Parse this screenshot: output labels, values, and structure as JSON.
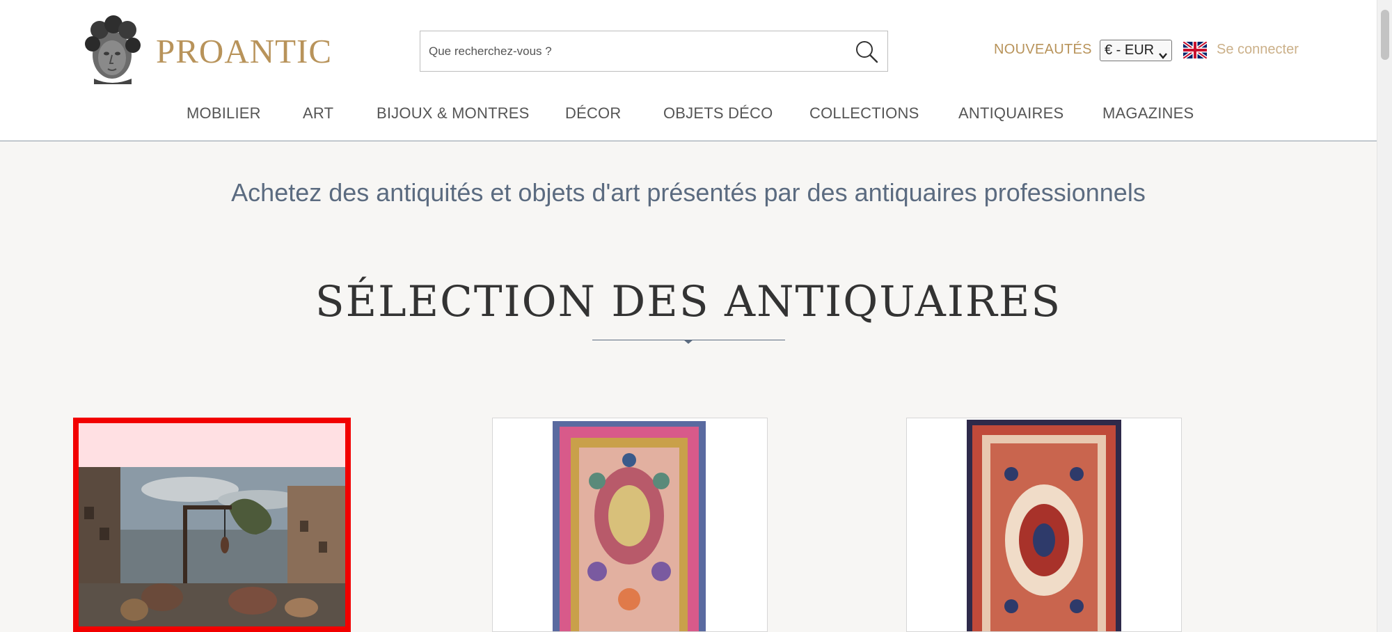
{
  "header": {
    "logo_text": "PROANTIC",
    "search": {
      "placeholder": "Que recherchez-vous ?",
      "value": ""
    },
    "new_label": "NOUVEAUTÉS",
    "currency_selected": "€ - EUR",
    "login_label": "Se connecter"
  },
  "nav": {
    "items": [
      "MOBILIER",
      "ART",
      "BIJOUX & MONTRES",
      "DÉCOR",
      "OBJETS DÉCO",
      "COLLECTIONS",
      "ANTIQUAIRES",
      "MAGAZINES"
    ]
  },
  "main": {
    "tagline": "Achetez des antiquités et objets d'art présentés par des antiquaires professionnels",
    "section_title": "SÉLECTION DES ANTIQUAIRES"
  },
  "colors": {
    "brand_gold": "#b8935a",
    "accent_slate": "#5b6b80",
    "selection_red": "#f20000"
  },
  "icons": {
    "search": "search-icon",
    "flag": "uk-flag-icon",
    "logo": "logo-bust-icon"
  }
}
